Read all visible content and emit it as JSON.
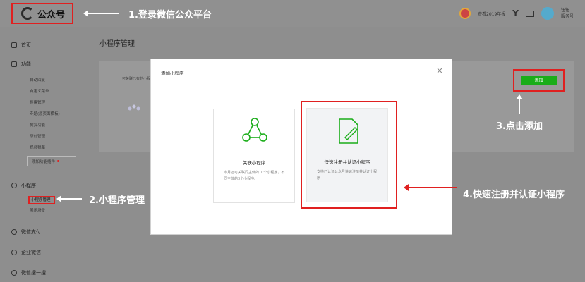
{
  "header": {
    "logo_text": "公众号",
    "icons": [
      "wechat-logo-icon",
      "reward-badge-icon",
      "y-icon",
      "mail-icon",
      "avatar"
    ],
    "year_label": "查看2019年报",
    "user_name": "钮钮",
    "user_sub": "服务号"
  },
  "sidebar": {
    "home": "首页",
    "features": "功能",
    "feature_items": [
      "自动回复",
      "自定义菜单",
      "投票管理",
      "专题(原页面模板)",
      "赞赏功能",
      "原创管理",
      "视频弹幕"
    ],
    "add_plugin": "添加功能插件",
    "mini_program": "小程序",
    "mini_items": [
      "小程序管理",
      "展示场景"
    ],
    "wechat_pay": "微信支付",
    "work_wechat": "企业微信",
    "search": "微信搜一搜"
  },
  "main": {
    "page_title": "小程序管理",
    "hint": "可关联已有的小程序",
    "add_button": "添加"
  },
  "modal": {
    "title": "添加小程序",
    "close": "×",
    "card1": {
      "title": "关联小程序",
      "desc": "本月还可关联同主体的10个小程序，不同主体的3个小程序。"
    },
    "card2": {
      "title": "快速注册并认证小程序",
      "desc": "支持已认证公众号快速注册并认证小程序"
    }
  },
  "annotations": {
    "step1": "1.登录微信公众平台",
    "step2": "2.小程序管理",
    "step3": "3.点击添加",
    "step4": "4.快速注册并认证小程序"
  },
  "colors": {
    "highlight": "#e02020",
    "primary": "#1aad19",
    "overlay": "#8e8e8e"
  }
}
